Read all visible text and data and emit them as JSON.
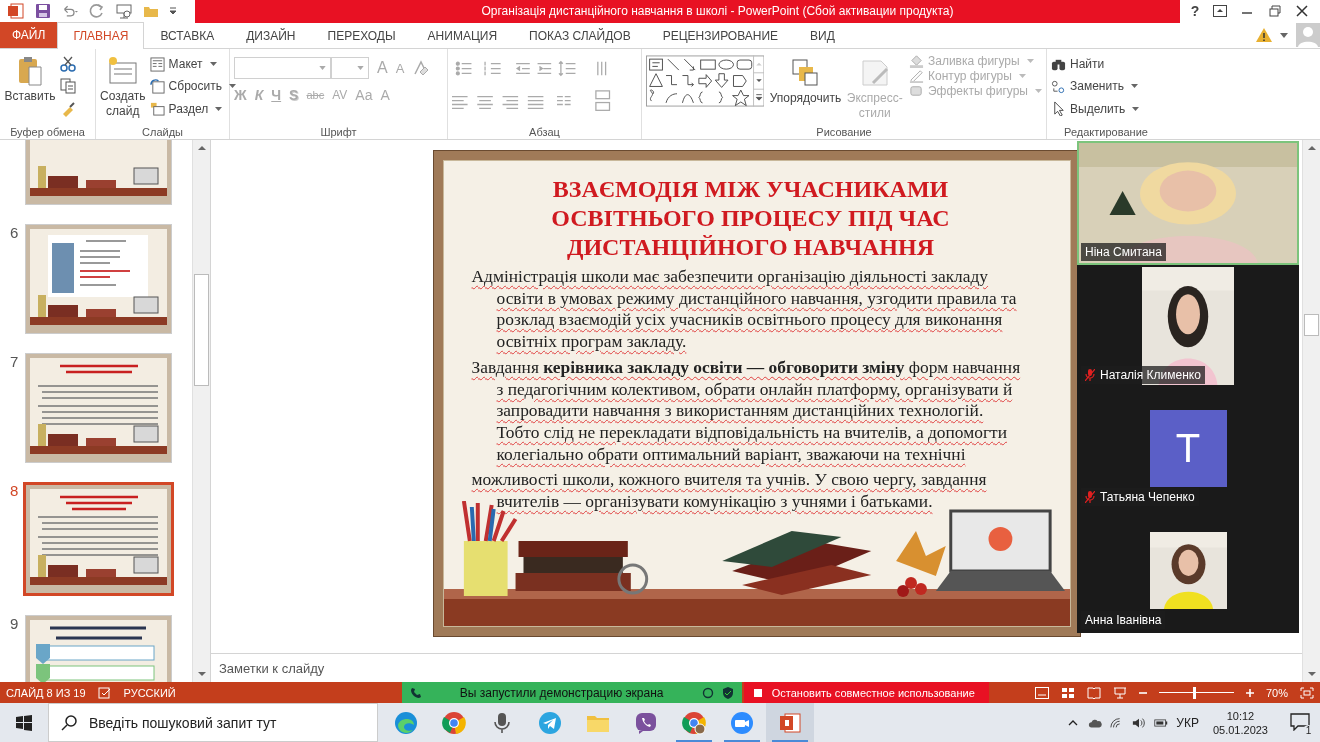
{
  "window": {
    "title": "Організація дистанційного навчання в школі - PowerPoint (Сбой активации продукта)",
    "help": "?"
  },
  "tabs": [
    {
      "label": "ФАЙЛ",
      "kind": "file",
      "selected": false
    },
    {
      "label": "ГЛАВНАЯ",
      "kind": "tab",
      "selected": true
    },
    {
      "label": "ВСТАВКА",
      "kind": "tab",
      "selected": false
    },
    {
      "label": "ДИЗАЙН",
      "kind": "tab",
      "selected": false
    },
    {
      "label": "ПЕРЕХОДЫ",
      "kind": "tab",
      "selected": false
    },
    {
      "label": "АНИМАЦИЯ",
      "kind": "tab",
      "selected": false
    },
    {
      "label": "ПОКАЗ СЛАЙДОВ",
      "kind": "tab",
      "selected": false
    },
    {
      "label": "РЕЦЕНЗИРОВАНИЕ",
      "kind": "tab",
      "selected": false
    },
    {
      "label": "ВИД",
      "kind": "tab",
      "selected": false
    }
  ],
  "ribbon": {
    "clipboard": {
      "label": "Буфер обмена",
      "paste": "Вставить"
    },
    "slides": {
      "label": "Слайды",
      "new_slide": "Создать слайд",
      "commands": [
        "Макет",
        "Сбросить",
        "Раздел"
      ]
    },
    "font": {
      "label": "Шрифт",
      "disabled": true,
      "size_buttons": [
        "A",
        "A"
      ],
      "format_buttons": [
        "Ж",
        "К",
        "Ч",
        "S",
        "abc",
        "AV",
        "Aa",
        "A"
      ]
    },
    "paragraph": {
      "label": "Абзац"
    },
    "drawing": {
      "label": "Рисование",
      "arrange": "Упорядочить",
      "quick_styles": "Экспресс-стили",
      "shape_commands": [
        {
          "label": "Заливка фигуры",
          "disabled": true
        },
        {
          "label": "Контур фигуры",
          "disabled": true
        },
        {
          "label": "Эффекты фигуры",
          "disabled": true
        }
      ]
    },
    "editing": {
      "label": "Редактирование",
      "commands": [
        {
          "label": "Найти",
          "kind": "find"
        },
        {
          "label": "Заменить",
          "kind": "replace"
        },
        {
          "label": "Выделить",
          "kind": "select"
        }
      ]
    }
  },
  "thumbnails": [
    {
      "selected": false,
      "kind": "timeline"
    },
    {
      "number": "6",
      "selected": false,
      "kind": "forecast"
    },
    {
      "number": "7",
      "selected": false,
      "kind": "regulation"
    },
    {
      "number": "8",
      "selected": true,
      "kind": "interaction"
    },
    {
      "number": "9",
      "selected": false,
      "kind": "requirements"
    }
  ],
  "slide": {
    "title_lines": [
      "ВЗАЄМОДІЯ МІЖ УЧАСНИКАМИ",
      "ОСВІТНЬОГО ПРОЦЕСУ ПІД ЧАС",
      "ДИСТАНЦІЙНОГО НАВЧАННЯ"
    ],
    "paragraphs": [
      "Адміністрація школи має забезпечити організацію діяльності закладу освіти в умовах режиму дистанційного навчання, узгодити правила та розклад взаємодій усіх учасників освітнього процесу для виконання освітніх програм закладу.",
      "Завдання **керівника закладу освіти — обговорити зміну** форм навчання з педагогічним колективом, обрати онлайн платформу, організувати й запровадити навчання з використанням дистанційних технологій. Тобто слід не перекладати відповідальність на вчителів, а допомогти колегіально обрати оптимальний варіант, зважаючи на технічні",
      "можливості школи, кожного вчителя та учнів. У свою чергу, завдання вчителів — організувати комунікацію з учнями і батьками."
    ]
  },
  "notes": {
    "placeholder": "Заметки к слайду"
  },
  "participants": [
    {
      "name": "Ніна Смитана",
      "kind": "video",
      "speaking": true,
      "muted": false
    },
    {
      "name": "Наталія Клименко",
      "kind": "video",
      "speaking": false,
      "muted": true
    },
    {
      "name": "Татьяна Чепенко",
      "kind": "avatar",
      "initial": "Т",
      "color": "#5b5fc7",
      "speaking": false,
      "muted": true
    },
    {
      "name": "Анна Іванівна",
      "kind": "video",
      "speaking": false,
      "muted": false
    }
  ],
  "status": {
    "slide": "СЛАЙД 8 ИЗ 19",
    "language": "РУССКИЙ",
    "share_banner": "Вы запустили демонстрацию экрана",
    "stop_share": "Остановить совместное использование",
    "zoom": {
      "level": 0.47,
      "reading": "70%"
    }
  },
  "taskbar": {
    "search": {
      "placeholder": "Введіть пошуковий запит тут"
    },
    "apps": [
      {
        "kind": "edge",
        "running": false,
        "active": false
      },
      {
        "kind": "chrome",
        "running": false,
        "active": false
      },
      {
        "kind": "microphone",
        "running": false,
        "active": false
      },
      {
        "kind": "telegram",
        "running": false,
        "active": false
      },
      {
        "kind": "folder",
        "running": false,
        "active": false
      },
      {
        "kind": "viber",
        "running": false,
        "active": false
      },
      {
        "kind": "chrome-profile",
        "running": true,
        "active": false
      },
      {
        "kind": "zoom",
        "running": true,
        "active": false
      },
      {
        "kind": "powerpoint",
        "running": true,
        "active": true
      }
    ],
    "language": "УКР",
    "time": "10:12",
    "date": "05.01.2023",
    "notifications": "1"
  }
}
